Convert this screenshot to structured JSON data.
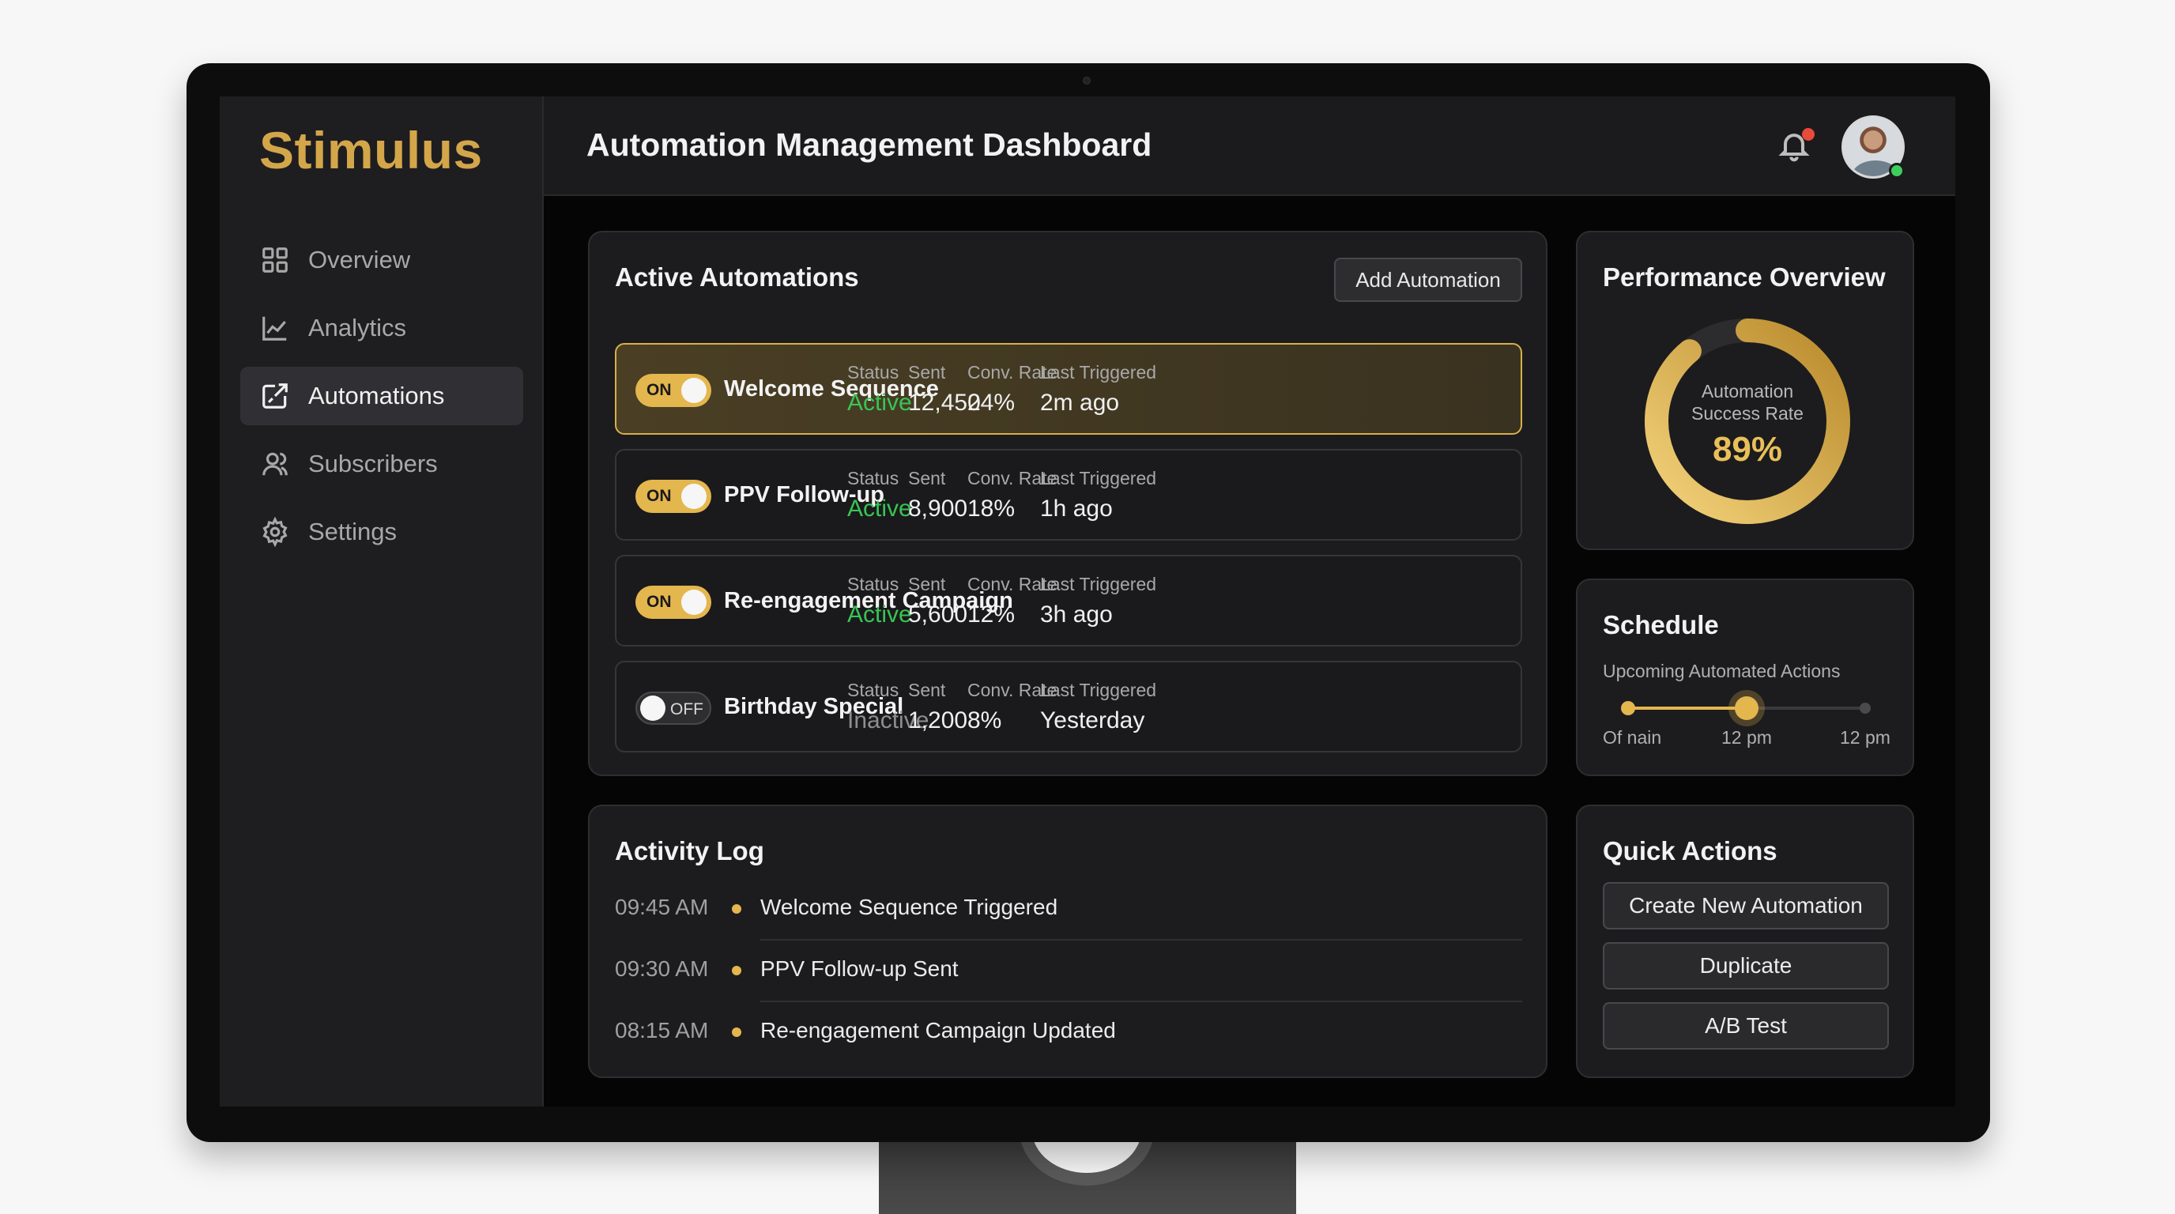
{
  "brand": "Stimulus",
  "header": {
    "title": "Automation Management Dashboard"
  },
  "sidebar": {
    "items": [
      {
        "label": "Overview",
        "icon": "grid-icon"
      },
      {
        "label": "Analytics",
        "icon": "chart-line-icon"
      },
      {
        "label": "Automations",
        "icon": "automation-icon",
        "active": true
      },
      {
        "label": "Subscribers",
        "icon": "users-icon"
      },
      {
        "label": "Settings",
        "icon": "gear-icon"
      }
    ]
  },
  "automations": {
    "title": "Active Automations",
    "add_label": "Add Automation",
    "column_labels": {
      "status": "Status",
      "sent": "Sent",
      "conv": "Conv. Rate",
      "last": "Last Triggered"
    },
    "rows": [
      {
        "toggle": "ON",
        "name": "Welcome Sequence",
        "status": "Active",
        "sent": "12,450",
        "conv": "24%",
        "last": "2m ago"
      },
      {
        "toggle": "ON",
        "name": "PPV Follow-up",
        "status": "Active",
        "sent": "8,900",
        "conv": "18%",
        "last": "1h ago"
      },
      {
        "toggle": "ON",
        "name": "Re-engagement Campaign",
        "status": "Active",
        "sent": "5,600",
        "conv": "12%",
        "last": "3h ago"
      },
      {
        "toggle": "OFF",
        "name": "Birthday Special",
        "status": "Inactive",
        "sent": "1,200",
        "conv": "8%",
        "last": "Yesterday"
      }
    ]
  },
  "performance": {
    "title": "Performance Overview",
    "label_line1": "Automation",
    "label_line2": "Success Rate",
    "value": "89%",
    "rate": 0.89
  },
  "schedule": {
    "title": "Schedule",
    "subtitle": "Upcoming Automated Actions",
    "labels": [
      "Of nain",
      "12 pm",
      "12 pm"
    ]
  },
  "activity": {
    "title": "Activity Log",
    "entries": [
      {
        "time": "09:45 AM",
        "message": "Welcome Sequence Triggered"
      },
      {
        "time": "09:30 AM",
        "message": "PPV Follow-up Sent"
      },
      {
        "time": "08:15 AM",
        "message": "Re-engagement Campaign Updated"
      }
    ]
  },
  "quick_actions": {
    "title": "Quick Actions",
    "buttons": [
      "Create New Automation",
      "Duplicate",
      "A/B Test"
    ]
  },
  "colors": {
    "accent": "#e4b64e",
    "brand": "#d4a64a",
    "active_status": "#39c454",
    "notification": "#e84a3c"
  }
}
